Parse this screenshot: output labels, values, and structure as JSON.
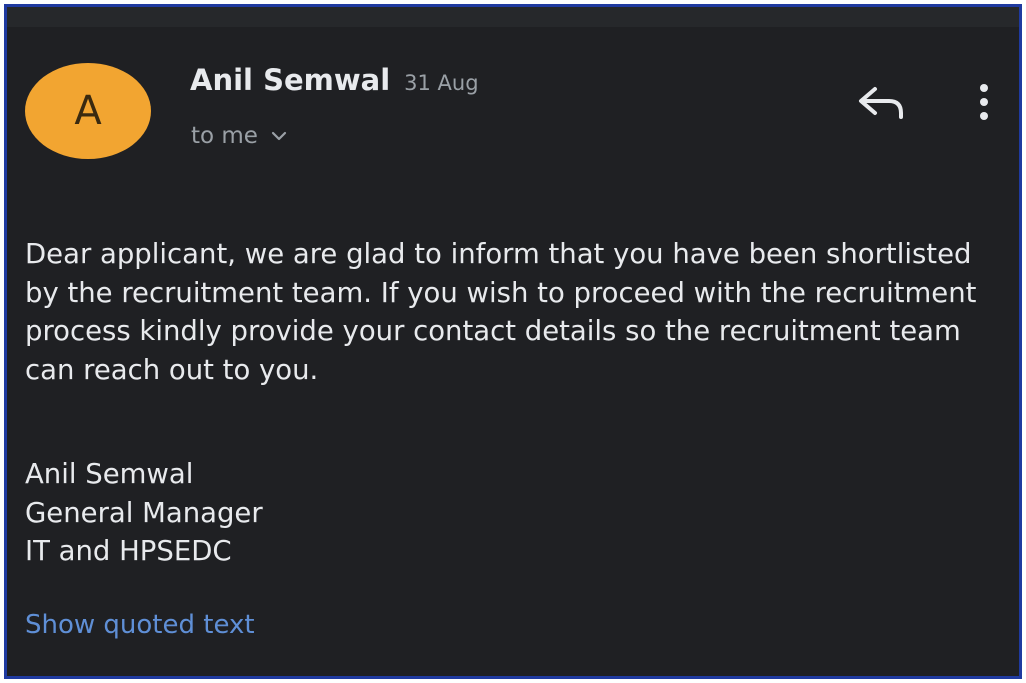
{
  "email": {
    "avatar_letter": "A",
    "sender_name": "Anil Semwal",
    "date": "31 Aug",
    "recipient": "to me",
    "body": "Dear applicant, we are glad to inform that you have been shortlisted by the recruitment team. If you wish to proceed with the recruitment process kindly provide your contact details so the recruitment team can reach out to you.",
    "signature": {
      "name": "Anil Semwal",
      "title": "General Manager",
      "org": "IT and HPSEDC"
    },
    "show_quoted_label": "Show quoted text"
  },
  "icons": {
    "reply": "reply-icon",
    "more": "more-vert-icon",
    "recipient_details": "chevron-down-icon"
  },
  "colors": {
    "background": "#1f2023",
    "avatar": "#f2a531",
    "text": "#e8eaed",
    "muted_text": "#9aa0a6",
    "link": "#5f8fd6",
    "border": "#1f3aa0"
  }
}
